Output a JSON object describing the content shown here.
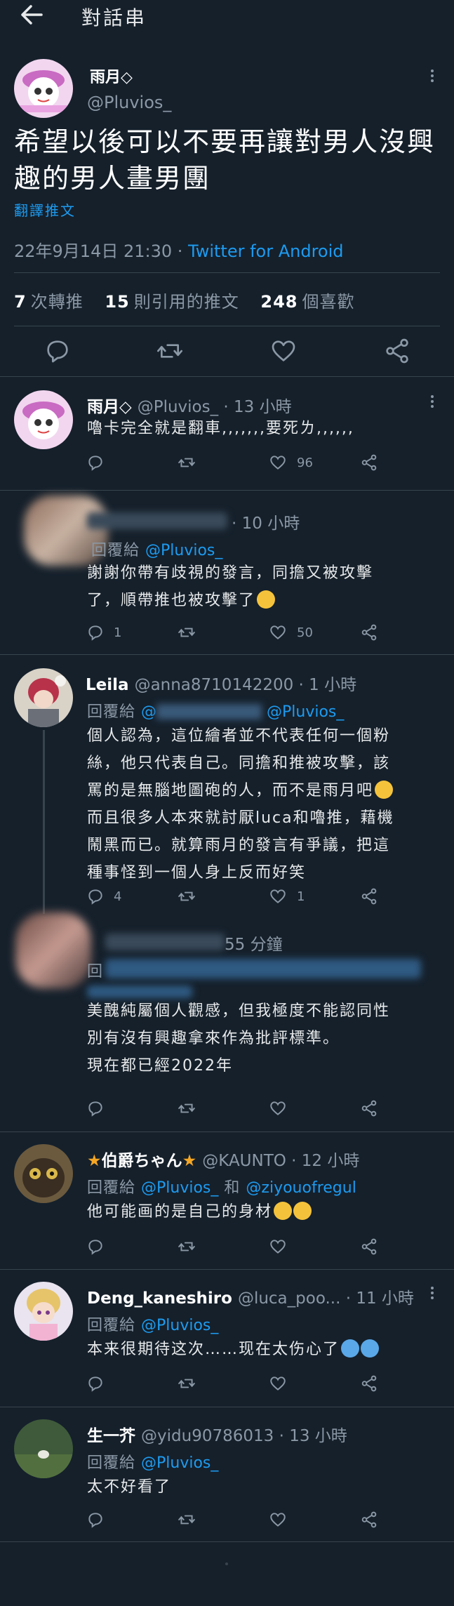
{
  "header": {
    "title": "對話串"
  },
  "main_tweet": {
    "name": "雨月◇",
    "handle": "@Pluvios_",
    "text_line1": "希望以後可以不要再讓對男人沒興",
    "text_line2": "趣的男人畫男團",
    "translate": "翻譯推文",
    "timestamp": "22年9月14日 21:30 · ",
    "source": "Twitter for Android",
    "stats": {
      "retweets": "7",
      "retweets_label": "次轉推",
      "quotes": "15",
      "quotes_label": "則引用的推文",
      "likes": "248",
      "likes_label": "個喜歡"
    }
  },
  "replies": [
    {
      "name": "雨月◇",
      "handle": "@Pluvios_ · 13 小時",
      "text": [
        "嚕卡完全就是翻車,,,,,,,要死ㄌ,,,,,,"
      ],
      "counts": {
        "reply": "",
        "retweet": "",
        "like": "96"
      }
    },
    {
      "name": "",
      "handle": "· 10 小時",
      "reply_prefix": "回覆給",
      "reply_to": "@Pluvios_",
      "text": [
        "謝謝你帶有歧視的發言，同擔又被攻擊",
        "了，順帶推也被攻擊了"
      ],
      "counts": {
        "reply": "1",
        "retweet": "",
        "like": "50"
      }
    },
    {
      "name": "Leila",
      "handle": "@anna8710142200 · 1 小時",
      "reply_prefix": "回覆給",
      "reply_to": "@Pluvios_",
      "text": [
        "個人認為，這位繪者並不代表任何一個粉",
        "絲，他只代表自己。同擔和推被攻擊，該",
        "罵的是無腦地圖砲的人，而不是雨月吧",
        "而且很多人本來就討厭luca和嚕推，藉機",
        "鬧黑而已。就算雨月的發言有爭議，把這",
        "種事怪到一個人身上反而好笑"
      ],
      "counts": {
        "reply": "4",
        "retweet": "",
        "like": "1"
      }
    },
    {
      "name": "",
      "handle": "55 分鐘",
      "reply_prefix": "回",
      "reply_to": "",
      "text": [
        "美醜純屬個人觀感，但我極度不能認同性",
        "別有沒有興趣拿來作為批評標準。",
        "現在都已經2022年"
      ],
      "counts": {
        "reply": "",
        "retweet": "",
        "like": ""
      }
    },
    {
      "name": "伯爵ちゃん",
      "handle": "@KAUNTO · 12 小時",
      "reply_prefix": "回覆給",
      "reply_to": "@Pluvios_",
      "reply_and": "和",
      "reply_to2": "@ziyouofregul",
      "text": [
        "他可能画的是自己的身材"
      ],
      "counts": {
        "reply": "",
        "retweet": "",
        "like": ""
      }
    },
    {
      "name": "Deng_kaneshiro",
      "handle": "@luca_poo... · 11 小時",
      "reply_prefix": "回覆給",
      "reply_to": "@Pluvios_",
      "text": [
        "本来很期待这次……现在太伤心了"
      ],
      "counts": {
        "reply": "",
        "retweet": "",
        "like": ""
      }
    },
    {
      "name": "生一芥",
      "handle": "@yidu90786013 · 13 小時",
      "reply_prefix": "回覆給",
      "reply_to": "@Pluvios_",
      "text": [
        "太不好看了"
      ],
      "counts": {
        "reply": "",
        "retweet": "",
        "like": ""
      }
    }
  ],
  "colors": {
    "background": "#15202b",
    "accent": "#1d9bf0",
    "muted": "#8b98a5",
    "divider": "#38444d"
  },
  "icons": [
    "back-arrow-icon",
    "more-icon",
    "reply-icon",
    "retweet-icon",
    "like-icon",
    "share-icon"
  ]
}
